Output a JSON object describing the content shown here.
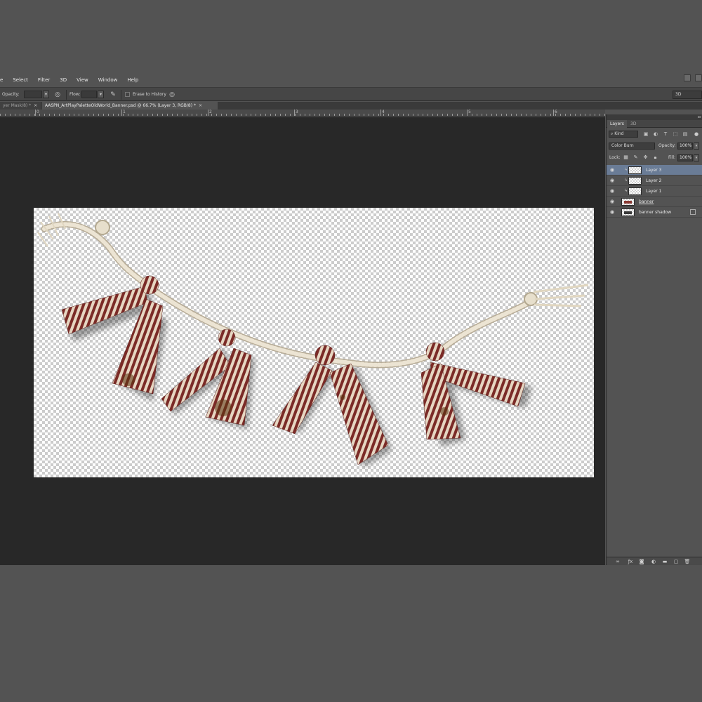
{
  "menu": {
    "items": [
      "e",
      "Select",
      "Filter",
      "3D",
      "View",
      "Window",
      "Help"
    ]
  },
  "options": {
    "opacity_label": "Opacity:",
    "flow_label": "Flow:",
    "erase_history_label": "Erase to History",
    "workspace": "3D"
  },
  "tabs": [
    {
      "label": "yer Mask/8) *",
      "active": false
    },
    {
      "label": "AASPN_ArtPlayPaletteOldWorld_Banner.psd @ 66.7% (Layer 3, RGB/8) *",
      "active": true
    }
  ],
  "ruler": {
    "labels": [
      "0",
      "1",
      "2",
      "3",
      "4",
      "5",
      "6",
      "7"
    ]
  },
  "panel": {
    "tabs": [
      "Layers",
      "3D"
    ],
    "kind": "Kind",
    "blend_mode": "Color Burn",
    "opacity_label": "Opacity:",
    "opacity_value": "100%",
    "lock_label": "Lock:",
    "fill_label": "Fill:",
    "fill_value": "100%",
    "layers": [
      {
        "name": "Layer 3",
        "clipped": true,
        "selected": true
      },
      {
        "name": "Layer 2",
        "clipped": true,
        "selected": false
      },
      {
        "name": "Layer 1",
        "clipped": true,
        "selected": false
      },
      {
        "name": "banner",
        "clipped": false,
        "selected": false,
        "underline": true
      },
      {
        "name": "banner shadow",
        "clipped": false,
        "selected": false,
        "smart": true
      }
    ]
  },
  "colors": {
    "selected_layer": "#6a7c96",
    "ribbon_red": "#7a2a26",
    "ribbon_cream": "#e8d8c4",
    "rope": "#e9e2d2"
  },
  "icons": {
    "visibility": "eye-icon",
    "clip": "clipping-arrow-icon"
  }
}
